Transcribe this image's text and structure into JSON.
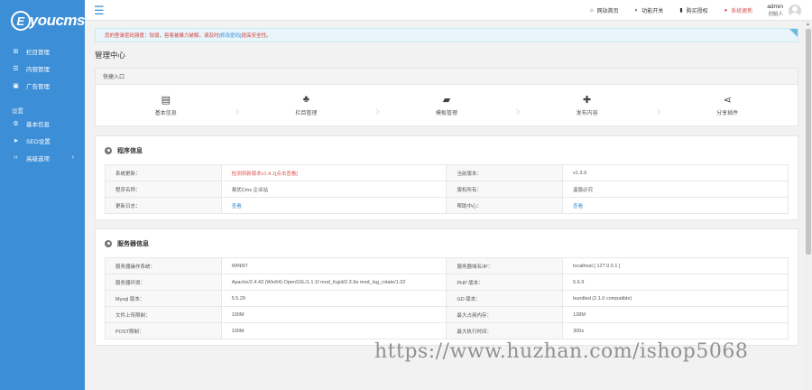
{
  "app": {
    "logo_letter": "E",
    "logo_text": "youcms"
  },
  "sidebar": {
    "items": [
      {
        "label": "栏目管理",
        "icon": "sitemap-icon"
      },
      {
        "label": "内容管理",
        "icon": "list-icon"
      },
      {
        "label": "广告管理",
        "icon": "image-icon"
      }
    ],
    "section_label": "设置",
    "settings_items": [
      {
        "label": "基本信息",
        "icon": "gear-icon"
      },
      {
        "label": "SEO设置",
        "icon": "send-icon"
      },
      {
        "label": "高级选项",
        "icon": "code-icon"
      }
    ]
  },
  "topbar": {
    "links": [
      {
        "label": "网站首页",
        "icon": "home-icon"
      },
      {
        "label": "功能开关",
        "icon": "toggle-icon"
      },
      {
        "label": "购买授权",
        "icon": "bookmark-icon"
      },
      {
        "label": "系统更新",
        "icon": "alert-icon"
      }
    ],
    "user_name": "admin",
    "user_role": "创始人"
  },
  "alert": {
    "text": "您的登录密码强度：较弱，容易被暴力破解，请及时",
    "link": "[修改密码]",
    "suffix": "提高安全性。"
  },
  "page_title": "管理中心",
  "shortcuts": {
    "title": "快捷入口",
    "items": [
      {
        "label": "基本信息",
        "icon": "id-card-icon"
      },
      {
        "label": "栏目管理",
        "icon": "sitemap-icon"
      },
      {
        "label": "模板管理",
        "icon": "folder-open-icon"
      },
      {
        "label": "发布内容",
        "icon": "plus-icon"
      },
      {
        "label": "分享插件",
        "icon": "share-icon"
      }
    ]
  },
  "program_info": {
    "title": "程序信息",
    "rows": [
      [
        "系统更新：",
        "检测到新版本v1.4.1[点击查看]",
        "当前版本：",
        "v1.3.9"
      ],
      [
        "程序名称：",
        "易优Cms 企业站",
        "版权所有：",
        "盗版必究"
      ],
      [
        "更新日志：",
        "查看",
        "帮助中心：",
        "查看"
      ]
    ]
  },
  "server_info": {
    "title": "服务器信息",
    "rows": [
      [
        "服务器操作系统：",
        "WINNT",
        "服务器域名/IP：",
        "localhost [ 127.0.0.1 ]"
      ],
      [
        "服务器环境：",
        "Apache/2.4.43 (Win64) OpenSSL/1.1.1f mod_fcgid/2.3.9a mod_log_rotate/1.02",
        "PHP 版本：",
        "5.6.9"
      ],
      [
        "Mysql 版本：",
        "5.5.29",
        "GD 版本：",
        "bundled (2.1.0 compatible)"
      ],
      [
        "文件上传限制：",
        "100M",
        "最大占用内存：",
        "128M"
      ],
      [
        "POST限制：",
        "100M",
        "最大执行时间：",
        "300s"
      ]
    ]
  },
  "watermark": "https://www.huzhan.com/ishop5068",
  "colors": {
    "sidebar": "#3c8ed6",
    "alert_text": "#d43f3a",
    "link": "#3c8ed6"
  }
}
